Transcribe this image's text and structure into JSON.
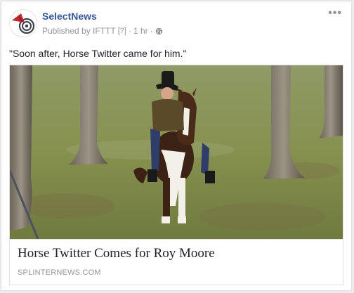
{
  "post": {
    "page_name": "SelectNews",
    "published_by": "Published by IFTTT",
    "help_marker": "[?]",
    "separator": "·",
    "time": "1 hr",
    "separator2": "·",
    "privacy_icon": "globe-icon",
    "more_icon": "more-options-icon",
    "more_label": "•••",
    "text": "\"Soon after, Horse Twitter came for him.\""
  },
  "attachment": {
    "image_icon": "photo-horse-rider",
    "title": "Horse Twitter Comes for Roy Moore",
    "domain": "SPLINTERNEWS.COM"
  },
  "colors": {
    "link_blue": "#365899",
    "meta_gray": "#90949c",
    "text_dark": "#1d2129",
    "border": "#dddfe2"
  }
}
